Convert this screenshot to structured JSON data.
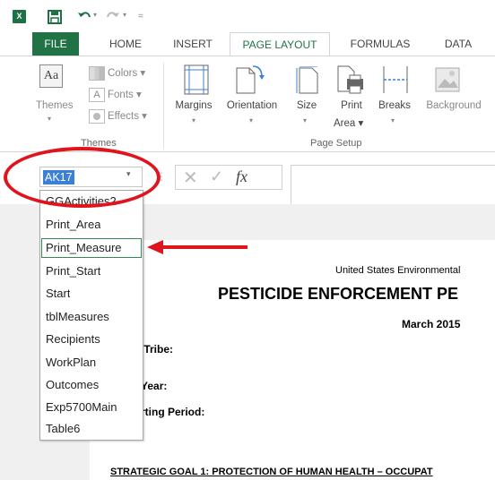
{
  "colors": {
    "excel_green": "#217346",
    "annotation_red": "#e0141d",
    "selection_blue": "#3c7fd6"
  },
  "tabs": [
    "FILE",
    "HOME",
    "INSERT",
    "PAGE LAYOUT",
    "FORMULAS",
    "DATA"
  ],
  "ribbon": {
    "themes": {
      "colors": "Colors",
      "fonts": "Fonts",
      "effects": "Effects",
      "themes": "Themes",
      "group_label": "Themes"
    },
    "page_setup": {
      "margins": "Margins",
      "orientation": "Orientation",
      "size": "Size",
      "print": "Print",
      "area": "Area",
      "breaks": "Breaks",
      "background": "Background",
      "group_label": "Page Setup"
    }
  },
  "name_box": {
    "value": "AK17"
  },
  "formula_bar": {
    "fx": "fx"
  },
  "dropdown": {
    "items": [
      "GGActivities2",
      "Print_Area",
      "Print_Measure",
      "Print_Start",
      "Start",
      "tblMeasures",
      "Recipients",
      "WorkPlan",
      "Outcomes",
      "Exp5700Main",
      "Table6"
    ],
    "highlighted": "Print_Measure"
  },
  "document": {
    "header": "United States Environmental",
    "title": "PESTICIDE ENFORCEMENT PE",
    "date": "March 2015",
    "field1": "/Tribe:",
    "field2": "Year:",
    "field3": "rting Period:",
    "goal": "STRATEGIC GOAL 1: PROTECTION OF HUMAN HEALTH – OCCUPAT"
  }
}
